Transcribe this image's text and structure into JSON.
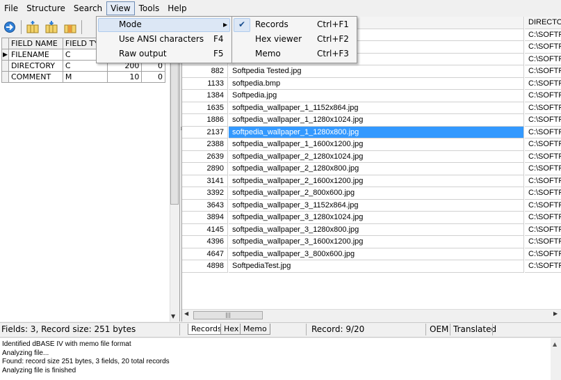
{
  "menubar": [
    "File",
    "Structure",
    "Search",
    "View",
    "Tools",
    "Help"
  ],
  "view_menu": {
    "items": [
      {
        "label": "Mode",
        "shortcut": "",
        "submenu": true
      },
      {
        "label": "Use ANSI characters",
        "shortcut": "F4"
      },
      {
        "label": "Raw output",
        "shortcut": "F5"
      }
    ]
  },
  "mode_menu": {
    "items": [
      {
        "label": "Records",
        "shortcut": "Ctrl+F1",
        "checked": true
      },
      {
        "label": "Hex viewer",
        "shortcut": "Ctrl+F2"
      },
      {
        "label": "Memo",
        "shortcut": "Ctrl+F3"
      }
    ]
  },
  "fields_grid": {
    "headers": [
      "FIELD NAME",
      "FIELD TY"
    ],
    "rows": [
      {
        "name": "FILENAME",
        "type": "C",
        "len": "",
        "dec": ""
      },
      {
        "name": "DIRECTORY",
        "type": "C",
        "len": "200",
        "dec": "0"
      },
      {
        "name": "COMMENT",
        "type": "M",
        "len": "10",
        "dec": "0"
      }
    ]
  },
  "records": {
    "dir_header": "DIRECTO",
    "rows": [
      {
        "rec": "",
        "name": "",
        "dir": "C:\\SOFTF"
      },
      {
        "rec": "",
        "name": "",
        "dir": "C:\\SOFTF"
      },
      {
        "rec": "",
        "name": "",
        "dir": "C:\\SOFTF"
      },
      {
        "rec": "882",
        "name": "Softpedia Tested.jpg",
        "dir": "C:\\SOFTF"
      },
      {
        "rec": "1133",
        "name": "softpedia.bmp",
        "dir": "C:\\SOFTF"
      },
      {
        "rec": "1384",
        "name": "Softpedia.jpg",
        "dir": "C:\\SOFTF"
      },
      {
        "rec": "1635",
        "name": "softpedia_wallpaper_1_1152x864.jpg",
        "dir": "C:\\SOFTF"
      },
      {
        "rec": "1886",
        "name": "softpedia_wallpaper_1_1280x1024.jpg",
        "dir": "C:\\SOFTF"
      },
      {
        "rec": "2137",
        "name": "softpedia_wallpaper_1_1280x800.jpg",
        "dir": "C:\\SOFTF",
        "selected": true
      },
      {
        "rec": "2388",
        "name": "softpedia_wallpaper_1_1600x1200.jpg",
        "dir": "C:\\SOFTF"
      },
      {
        "rec": "2639",
        "name": "softpedia_wallpaper_2_1280x1024.jpg",
        "dir": "C:\\SOFTF"
      },
      {
        "rec": "2890",
        "name": "softpedia_wallpaper_2_1280x800.jpg",
        "dir": "C:\\SOFTF"
      },
      {
        "rec": "3141",
        "name": "softpedia_wallpaper_2_1600x1200.jpg",
        "dir": "C:\\SOFTF"
      },
      {
        "rec": "3392",
        "name": "softpedia_wallpaper_2_800x600.jpg",
        "dir": "C:\\SOFTF"
      },
      {
        "rec": "3643",
        "name": "softpedia_wallpaper_3_1152x864.jpg",
        "dir": "C:\\SOFTF"
      },
      {
        "rec": "3894",
        "name": "softpedia_wallpaper_3_1280x1024.jpg",
        "dir": "C:\\SOFTF"
      },
      {
        "rec": "4145",
        "name": "softpedia_wallpaper_3_1280x800.jpg",
        "dir": "C:\\SOFTF"
      },
      {
        "rec": "4396",
        "name": "softpedia_wallpaper_3_1600x1200.jpg",
        "dir": "C:\\SOFTF"
      },
      {
        "rec": "4647",
        "name": "softpedia_wallpaper_3_800x600.jpg",
        "dir": "C:\\SOFTF"
      },
      {
        "rec": "4898",
        "name": "SoftpediaTest.jpg",
        "dir": "C:\\SOFTF"
      }
    ]
  },
  "status": {
    "fields_info": "Fields: 3, Record size: 251 bytes",
    "tabs": [
      "Records",
      "Hex",
      "Memo"
    ],
    "record": "Record: 9/20",
    "charset": "OEM",
    "translated": "Translated"
  },
  "log": [
    "Identified dBASE IV with memo file format",
    "Analyzing file...",
    "Found: record size 251 bytes, 3 fields, 20 total records",
    "Analyzing file is finished"
  ],
  "colors": {
    "selection": "#3399ff",
    "menu_highlight": "#dce7f5"
  }
}
